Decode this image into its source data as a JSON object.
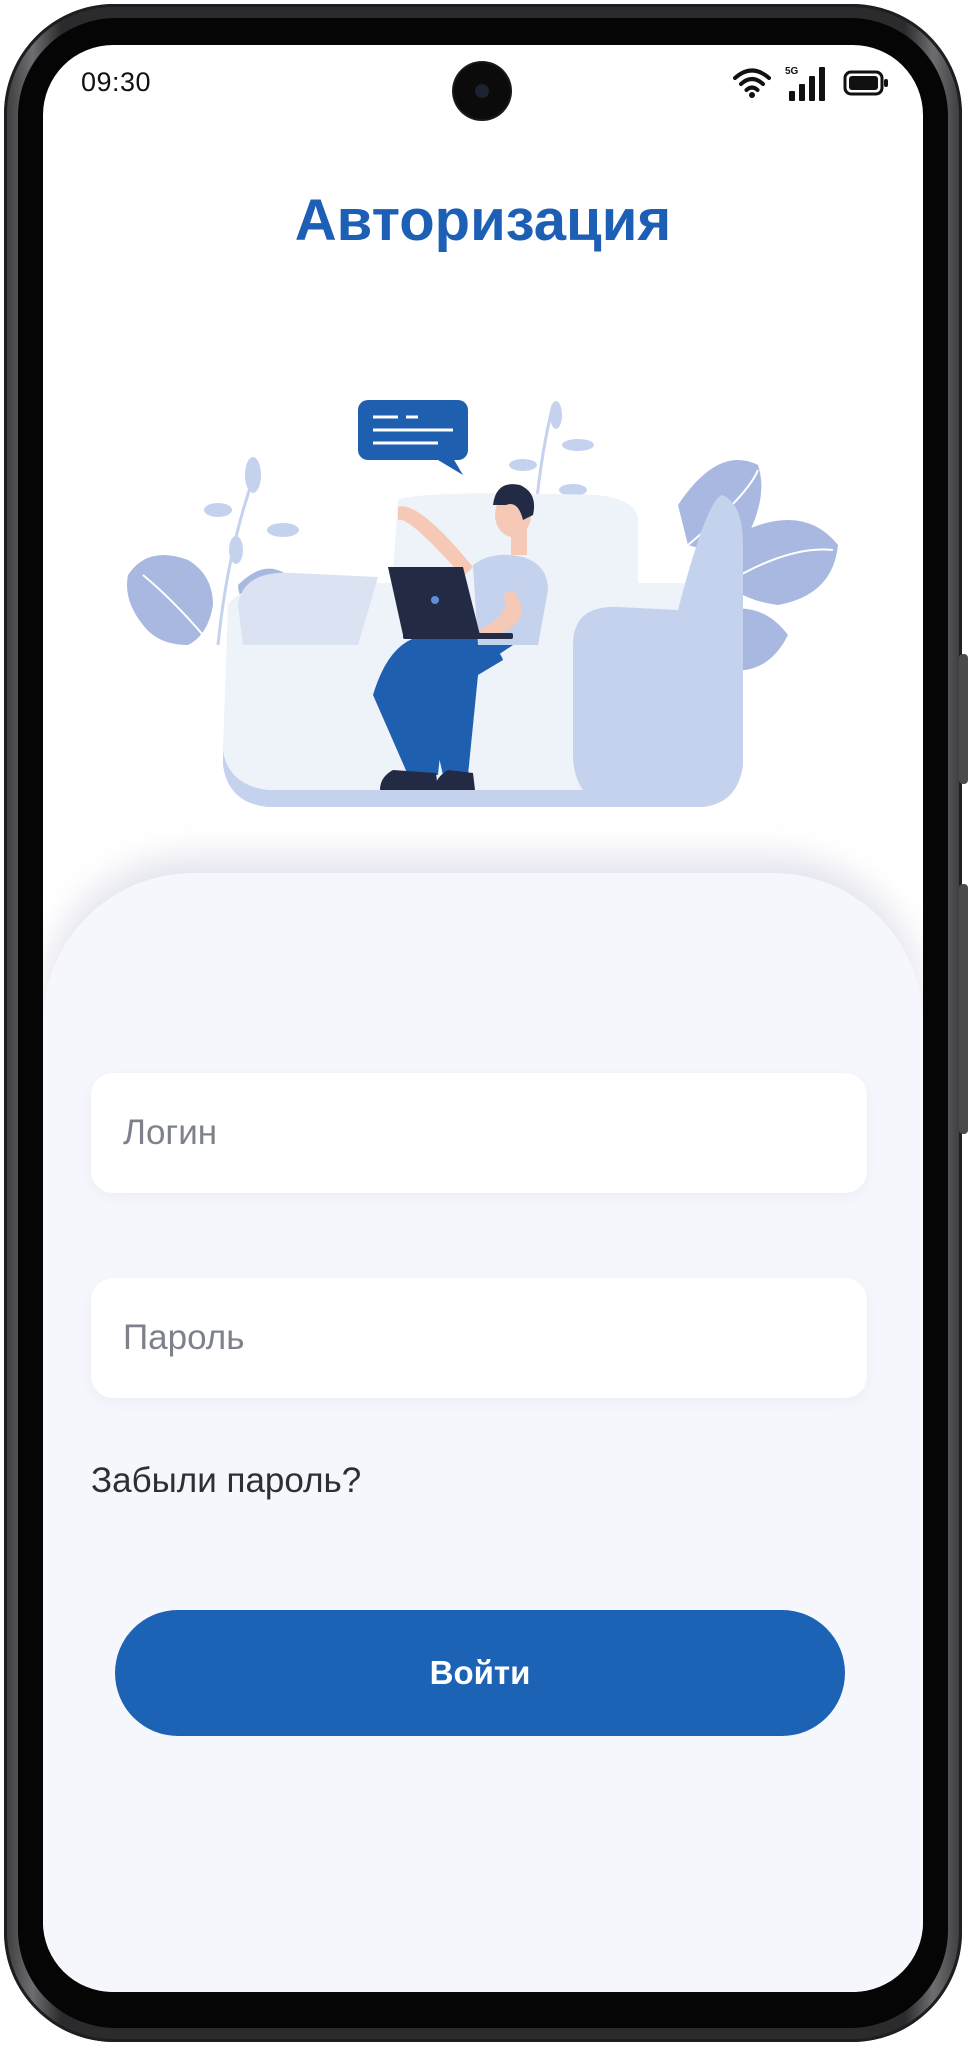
{
  "status_bar": {
    "time": "09:30",
    "network_label": "5G",
    "icons": [
      "wifi-icon",
      "cellular-signal-icon",
      "battery-icon"
    ]
  },
  "screen": {
    "title": "Авторизация",
    "illustration": "man-with-laptop-illustration"
  },
  "form": {
    "login_placeholder": "Логин",
    "login_value": "",
    "password_placeholder": "Пароль",
    "password_value": "",
    "forgot_password_label": "Забыли пароль?",
    "submit_label": "Войти"
  },
  "colors": {
    "accent": "#1c63b6",
    "title": "#1c5fb4",
    "card_background": "#f6f7fc",
    "illustration_light": "#c5d2ee",
    "illustration_dark": "#1f5fb0"
  }
}
